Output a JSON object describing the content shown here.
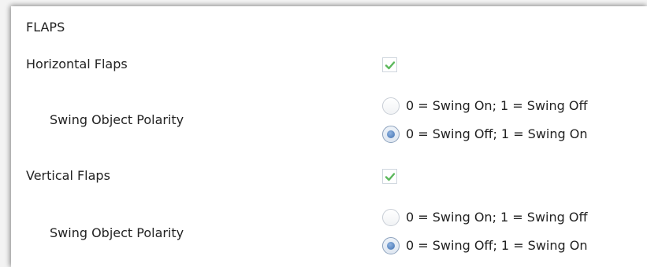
{
  "section": {
    "title": "FLAPS"
  },
  "horizontal": {
    "label": "Horizontal Flaps",
    "checked": true,
    "polarity_label": "Swing Object Polarity",
    "options": [
      {
        "label": "0 = Swing On; 1 = Swing Off",
        "selected": false
      },
      {
        "label": "0 = Swing Off; 1 = Swing On",
        "selected": true
      }
    ]
  },
  "vertical": {
    "label": "Vertical Flaps",
    "checked": true,
    "polarity_label": "Swing Object Polarity",
    "options": [
      {
        "label": "0 = Swing On; 1 = Swing Off",
        "selected": false
      },
      {
        "label": "0 = Swing Off; 1 = Swing On",
        "selected": true
      }
    ]
  },
  "colors": {
    "checkmark": "#5cb85c",
    "radio_selected": "#3e6fb0",
    "text": "#222222"
  },
  "icons": {
    "checkbox_mark": "checkmark-icon",
    "radio_dot": "radio-dot-icon"
  }
}
